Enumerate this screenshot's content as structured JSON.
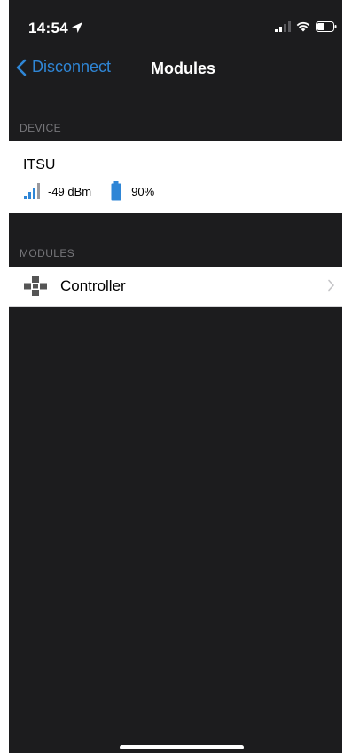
{
  "status_bar": {
    "time": "14:54"
  },
  "nav": {
    "back_label": "Disconnect",
    "title": "Modules"
  },
  "sections": {
    "device_header": "DEVICE",
    "modules_header": "MODULES"
  },
  "device": {
    "name": "ITSU",
    "signal": "-49 dBm",
    "battery": "90%",
    "battery_level": 0.9,
    "signal_bars_active": 3
  },
  "modules": [
    {
      "label": "Controller",
      "icon": "gamepad-icon"
    }
  ],
  "colors": {
    "accent": "#2f86d6",
    "background": "#1c1c1e",
    "cell": "#ffffff",
    "section_text": "#76767a"
  }
}
